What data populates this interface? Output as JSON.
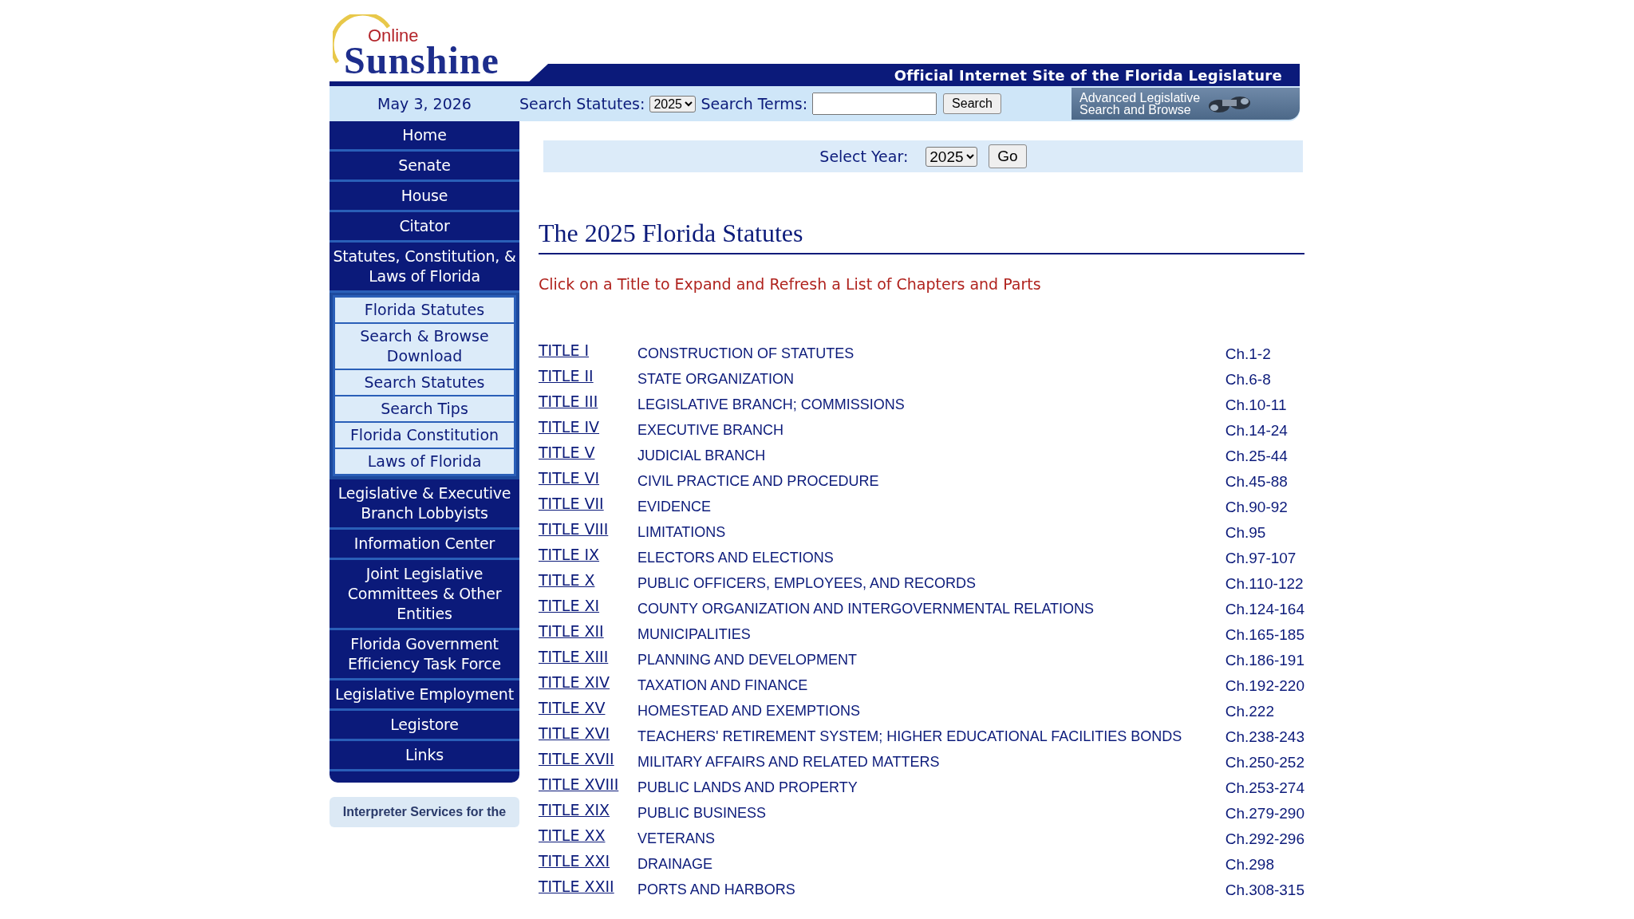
{
  "header": {
    "logo_small": "Online",
    "logo_big": "Sunshine",
    "tagline": "Official Internet Site of the Florida Legislature"
  },
  "search_bar": {
    "date": "May 3, 2026",
    "statutes_label": "Search Statutes:",
    "statutes_year": "2025",
    "terms_label": "Search Terms:",
    "search_button": "Search",
    "advanced_line1": "Advanced Legislative",
    "advanced_line2": "Search and Browse"
  },
  "sidebar": {
    "items": [
      {
        "label": "Home"
      },
      {
        "label": "Senate"
      },
      {
        "label": "House"
      },
      {
        "label": "Citator"
      },
      {
        "label": "Statutes, Constitution, & Laws of Florida",
        "children": [
          {
            "label": "Florida Statutes"
          },
          {
            "label": "Search & Browse Download"
          },
          {
            "label": "Search Statutes"
          },
          {
            "label": "Search Tips"
          },
          {
            "label": "Florida Constitution"
          },
          {
            "label": "Laws of Florida"
          }
        ]
      },
      {
        "label": "Legislative & Executive Branch Lobbyists"
      },
      {
        "label": "Information Center"
      },
      {
        "label": "Joint Legislative Committees & Other Entities"
      },
      {
        "label": "Florida Government Efficiency Task Force"
      },
      {
        "label": "Legislative Employment"
      },
      {
        "label": "Legistore"
      },
      {
        "label": "Links"
      }
    ],
    "notice": "Interpreter Services for the"
  },
  "year_bar": {
    "label": "Select Year:",
    "year": "2025",
    "button": "Go"
  },
  "heading": "The 2025 Florida Statutes",
  "instruction": "Click on a Title to Expand and Refresh a List of Chapters and Parts",
  "titles": [
    {
      "title": "TITLE I",
      "name": "CONSTRUCTION OF STATUTES",
      "chapters": "Ch.1-2"
    },
    {
      "title": "TITLE II",
      "name": "STATE ORGANIZATION",
      "chapters": "Ch.6-8"
    },
    {
      "title": "TITLE III",
      "name": "LEGISLATIVE BRANCH; COMMISSIONS",
      "chapters": "Ch.10-11"
    },
    {
      "title": "TITLE IV",
      "name": "EXECUTIVE BRANCH",
      "chapters": "Ch.14-24"
    },
    {
      "title": "TITLE V",
      "name": "JUDICIAL BRANCH",
      "chapters": "Ch.25-44"
    },
    {
      "title": "TITLE VI",
      "name": "CIVIL PRACTICE AND PROCEDURE",
      "chapters": "Ch.45-88"
    },
    {
      "title": "TITLE VII",
      "name": "EVIDENCE",
      "chapters": "Ch.90-92"
    },
    {
      "title": "TITLE VIII",
      "name": "LIMITATIONS",
      "chapters": "Ch.95"
    },
    {
      "title": "TITLE IX",
      "name": "ELECTORS AND ELECTIONS",
      "chapters": "Ch.97-107"
    },
    {
      "title": "TITLE X",
      "name": "PUBLIC OFFICERS, EMPLOYEES, AND RECORDS",
      "chapters": "Ch.110-122"
    },
    {
      "title": "TITLE XI",
      "name": "COUNTY ORGANIZATION AND INTERGOVERNMENTAL RELATIONS",
      "chapters": "Ch.124-164"
    },
    {
      "title": "TITLE XII",
      "name": "MUNICIPALITIES",
      "chapters": "Ch.165-185"
    },
    {
      "title": "TITLE XIII",
      "name": "PLANNING AND DEVELOPMENT",
      "chapters": "Ch.186-191"
    },
    {
      "title": "TITLE XIV",
      "name": "TAXATION AND FINANCE",
      "chapters": "Ch.192-220"
    },
    {
      "title": "TITLE XV",
      "name": "HOMESTEAD AND EXEMPTIONS",
      "chapters": "Ch.222"
    },
    {
      "title": "TITLE XVI",
      "name": "TEACHERS' RETIREMENT SYSTEM; HIGHER EDUCATIONAL FACILITIES BONDS",
      "chapters": "Ch.238-243"
    },
    {
      "title": "TITLE XVII",
      "name": "MILITARY AFFAIRS AND RELATED MATTERS",
      "chapters": "Ch.250-252"
    },
    {
      "title": "TITLE XVIII",
      "name": "PUBLIC LANDS AND PROPERTY",
      "chapters": "Ch.253-274"
    },
    {
      "title": "TITLE XIX",
      "name": "PUBLIC BUSINESS",
      "chapters": "Ch.279-290"
    },
    {
      "title": "TITLE XX",
      "name": "VETERANS",
      "chapters": "Ch.292-296"
    },
    {
      "title": "TITLE XXI",
      "name": "DRAINAGE",
      "chapters": "Ch.298"
    },
    {
      "title": "TITLE XXII",
      "name": "PORTS AND HARBORS",
      "chapters": "Ch.308-315"
    }
  ]
}
